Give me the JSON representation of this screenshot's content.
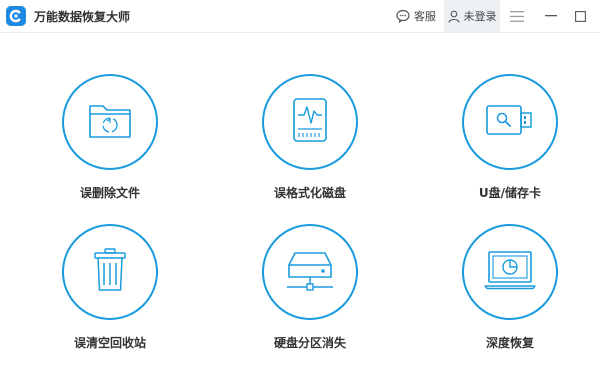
{
  "app": {
    "title": "万能数据恢复大师",
    "logo_icon": "app-logo-icon",
    "accent_color": "#1a9bde"
  },
  "titlebar": {
    "support_label": "客服",
    "login_label": "未登录",
    "menu_icon": "hamburger-icon",
    "minimize_icon": "minimize-icon",
    "maximize_icon": "maximize-icon"
  },
  "features": [
    {
      "label": "误删除文件",
      "icon": "folder-recycle-icon"
    },
    {
      "label": "误格式化磁盘",
      "icon": "disk-pulse-icon"
    },
    {
      "label": "U盘/储存卡",
      "icon": "usb-drive-icon"
    },
    {
      "label": "误清空回收站",
      "icon": "trash-bin-icon"
    },
    {
      "label": "硬盘分区消失",
      "icon": "network-drive-icon"
    },
    {
      "label": "深度恢复",
      "icon": "monitor-scan-icon"
    }
  ]
}
